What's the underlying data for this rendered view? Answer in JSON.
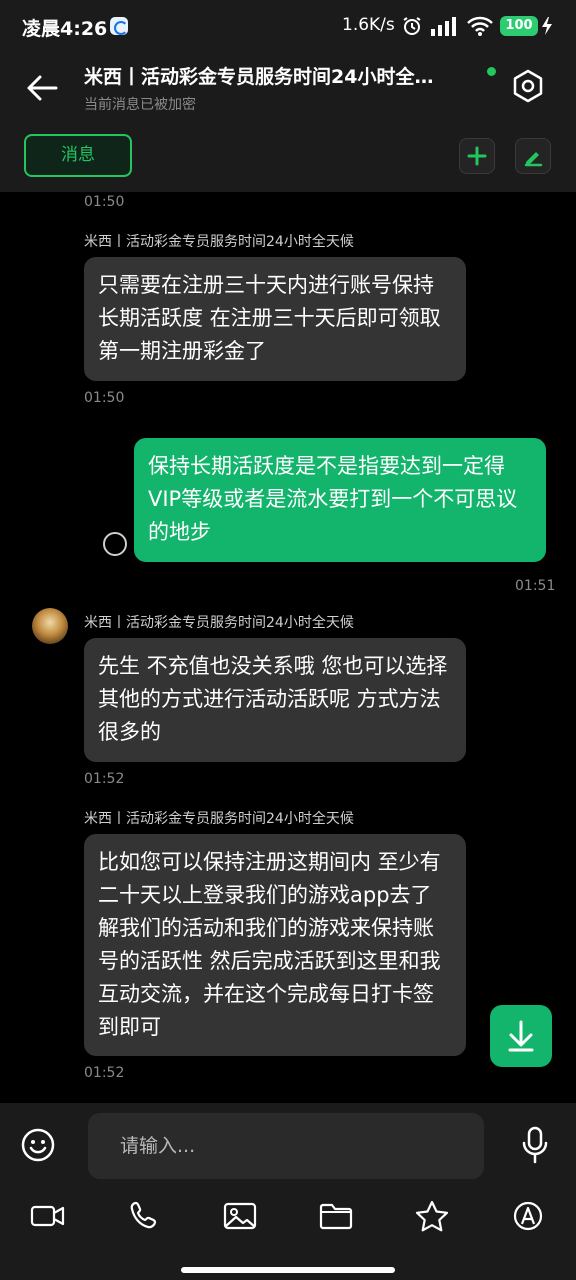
{
  "status_bar": {
    "time": "凌晨4:26",
    "network_speed": "1.6K/s",
    "battery": "100"
  },
  "header": {
    "title": "米西丨活动彩金专员服务时间24小时全…",
    "subtitle": "当前消息已被加密",
    "tab_label": "消息"
  },
  "messages": {
    "t0": "01:50",
    "sender_name": "米西丨活动彩金专员服务时间24小时全天候",
    "m1_text": "只需要在注册三十天内进行账号保持长期活跃度 在注册三十天后即可领取第一期注册彩金了",
    "m1_time": "01:50",
    "m2_text": "保持长期活跃度是不是指要达到一定得VIP等级或者是流水要打到一个不可思议的地步",
    "m2_time": "01:51",
    "m3_text": "先生 不充值也没关系哦 您也可以选择其他的方式进行活动活跃呢 方式方法很多的",
    "m3_time": "01:52",
    "m4_text": "比如您可以保持注册这期间内 至少有二十天以上登录我们的游戏app去了解我们的活动和我们的游戏来保持账号的活跃性 然后完成活跃到这里和我互动交流，并在这个完成每日打卡签到即可",
    "m4_time": "01:52"
  },
  "input": {
    "placeholder": "请输入..."
  },
  "colors": {
    "accent": "#13b46c",
    "bubble_incoming": "#343434",
    "background": "#000000",
    "bar": "#1b1b1b"
  },
  "icons": [
    "back-arrow-icon",
    "settings-icon",
    "plus-icon",
    "edit-icon",
    "download-icon",
    "emoji-icon",
    "mic-icon",
    "video-icon",
    "phone-icon",
    "image-icon",
    "folder-icon",
    "star-icon",
    "at-icon"
  ]
}
